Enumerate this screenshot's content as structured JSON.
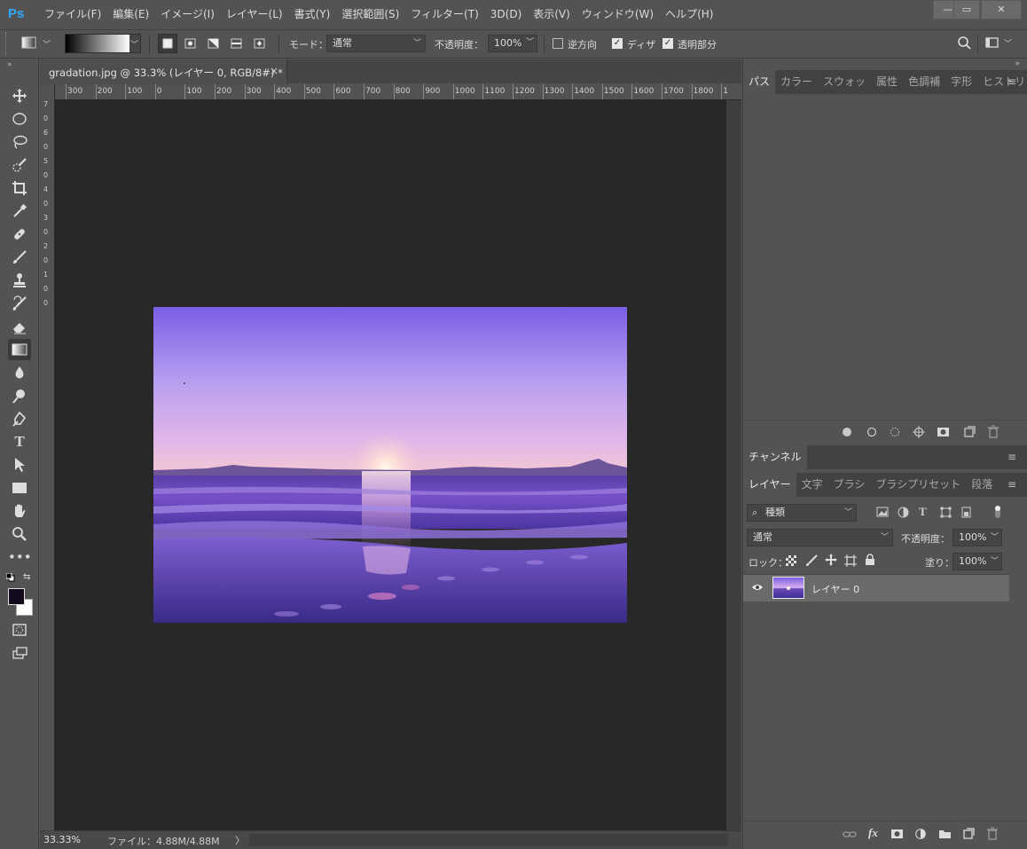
{
  "app": {
    "logo": "Ps",
    "menu": [
      "ファイル(F)",
      "編集(E)",
      "イメージ(I)",
      "レイヤー(L)",
      "書式(Y)",
      "選択範囲(S)",
      "フィルター(T)",
      "3D(D)",
      "表示(V)",
      "ウィンドウ(W)",
      "ヘルプ(H)"
    ],
    "window_controls": [
      "—",
      "▭",
      "✕"
    ]
  },
  "options": {
    "mode_label": "モード：",
    "mode_value": "通常",
    "opacity_label": "不透明度：",
    "opacity_value": "100%",
    "reverse_label": "逆方向",
    "dither_label": "ディザ",
    "transparency_label": "透明部分",
    "reverse_checked": false,
    "dither_checked": true,
    "transparency_checked": true
  },
  "document": {
    "tab_title": "gradation.jpg @ 33.3% (レイヤー 0, RGB/8#) *",
    "tab_close": "×",
    "ruler_top_ticks": [
      "300",
      "200",
      "100",
      "0",
      "100",
      "200",
      "300",
      "400",
      "500",
      "600",
      "700",
      "800",
      "900",
      "1000",
      "1100",
      "1200",
      "1300",
      "1400",
      "1500",
      "1600",
      "1700",
      "1800",
      "1"
    ],
    "ruler_left_ticks": [
      "7",
      "0",
      "6",
      "0",
      "5",
      "0",
      "4",
      "0",
      "3",
      "0",
      "2",
      "0",
      "1",
      "0",
      "0"
    ],
    "zoom": "33.33%",
    "file_info": "ファイル：4.88M/4.88M",
    "status_arrow": "〉"
  },
  "panels": {
    "top_tabs": [
      "パス",
      "カラー",
      "スウォッ",
      "属性",
      "色調補",
      "字形",
      "ヒストリ"
    ],
    "channel_tab": "チャンネル",
    "layer_tabs": [
      "レイヤー",
      "文字",
      "ブラシ",
      "ブラシプリセット",
      "段落"
    ],
    "filter_kind": "種類",
    "blend_mode": "通常",
    "opacity_label": "不透明度：",
    "opacity_value": "100%",
    "lock_label": "ロック：",
    "fill_label": "塗り：",
    "fill_value": "100%",
    "layers": [
      {
        "name": "レイヤー 0",
        "visible": true,
        "selected": true
      }
    ]
  },
  "colors": {
    "ui_bg": "#535353",
    "canvas_bg": "#282828",
    "accent": "#31a8ff"
  }
}
